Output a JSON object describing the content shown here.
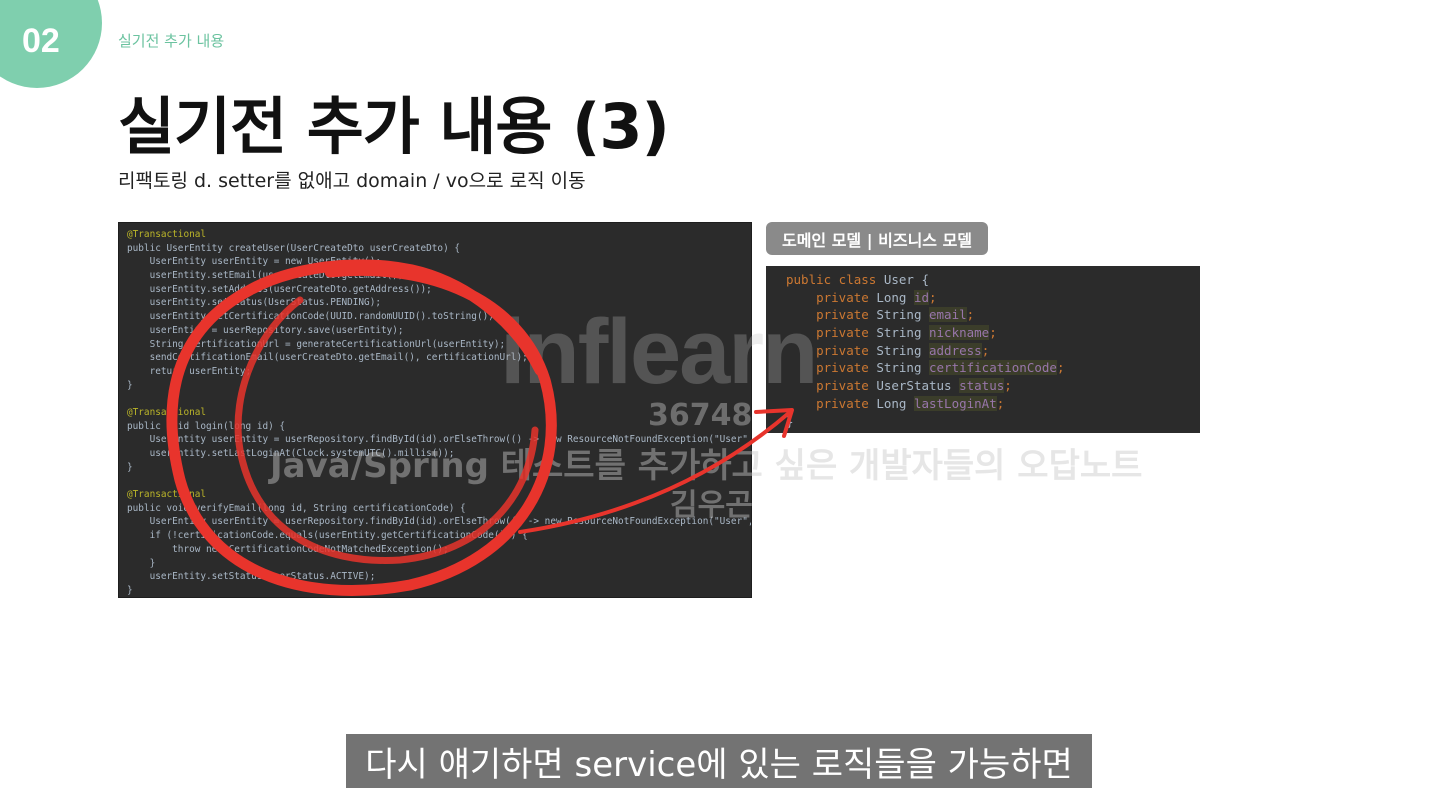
{
  "slide": {
    "number": "02",
    "section_label": "실기전 추가 내용",
    "title": "실기전 추가 내용 (3)",
    "subtitle": "리팩토링 d. setter를 없애고 domain / vo으로 로직 이동"
  },
  "left_code": {
    "lines": [
      "@Transactional",
      "public UserEntity createUser(UserCreateDto userCreateDto) {",
      "    UserEntity userEntity = new UserEntity();",
      "    userEntity.setEmail(userCreateDto.getEmail());",
      "    userEntity.setAddress(userCreateDto.getAddress());",
      "    userEntity.setStatus(UserStatus.PENDING);",
      "    userEntity.setCertificationCode(UUID.randomUUID().toString());",
      "    userEntity = userRepository.save(userEntity);",
      "    String certificationUrl = generateCertificationUrl(userEntity);",
      "    sendCertificationEmail(userCreateDto.getEmail(), certificationUrl);",
      "    return userEntity;",
      "}",
      "",
      "@Transactional",
      "public void login(long id) {",
      "    UserEntity userEntity = userRepository.findById(id).orElseThrow(() -> new ResourceNotFoundException(\"User\", id));",
      "    userEntity.setLastLoginAt(Clock.systemUTC().millis());",
      "}",
      "",
      "@Transactional",
      "public void verifyEmail(long id, String certificationCode) {",
      "    UserEntity userEntity = userRepository.findById(id).orElseThrow(() -> new ResourceNotFoundException(\"User\", id));",
      "    if (!certificationCode.equals(userEntity.getCertificationCode())) {",
      "        throw new CertificationCodeNotMatchedException();",
      "    }",
      "    userEntity.setStatus(UserStatus.ACTIVE);",
      "}"
    ]
  },
  "model_label": "도메인 모델 | 비즈니스 모델",
  "right_code": {
    "header": "public class User {",
    "fields": [
      {
        "type": "Long",
        "name": "id"
      },
      {
        "type": "String",
        "name": "email"
      },
      {
        "type": "String",
        "name": "nickname"
      },
      {
        "type": "String",
        "name": "address"
      },
      {
        "type": "String",
        "name": "certificationCode"
      },
      {
        "type": "UserStatus",
        "name": "status"
      },
      {
        "type": "Long",
        "name": "lastLoginAt"
      }
    ],
    "modifier": "private",
    "footer": "}"
  },
  "watermark": {
    "logo": "inflearn",
    "id": "36748",
    "course": "Java/Spring 테스트를 추가하고 싶은 개발자들의 오답노트",
    "author": "김우곤"
  },
  "caption": "다시 얘기하면 service에 있는 로직들을 가능하면",
  "colors": {
    "accent": "#7fcfae",
    "editor_bg": "#2b2b2b",
    "annotation_red": "#e8342c"
  }
}
